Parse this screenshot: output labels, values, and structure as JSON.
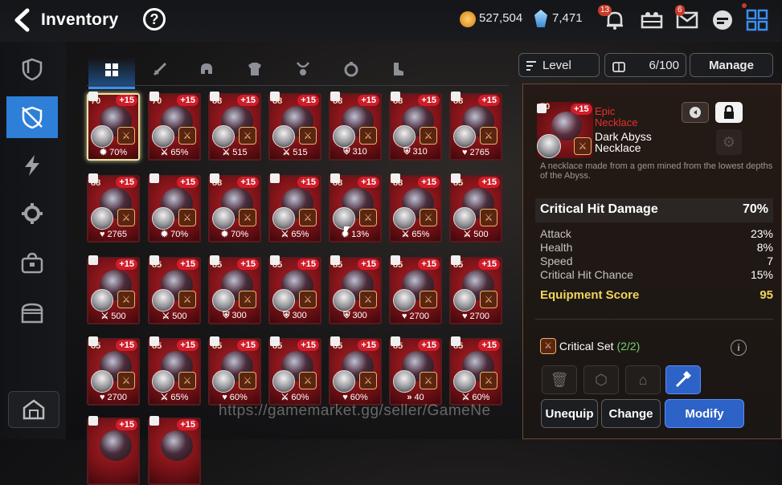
{
  "header": {
    "title": "Inventory",
    "gold": "527,504",
    "crystals": "7,471",
    "notification_count": "13",
    "mail_count": "6"
  },
  "tabs": [
    {
      "name": "all",
      "icon": "grid-icon",
      "active": true
    },
    {
      "name": "weapon",
      "icon": "sword-icon"
    },
    {
      "name": "helmet",
      "icon": "helmet-icon"
    },
    {
      "name": "armor",
      "icon": "armor-icon"
    },
    {
      "name": "necklace",
      "icon": "necklace-icon"
    },
    {
      "name": "ring",
      "icon": "ring-icon"
    },
    {
      "name": "boots",
      "icon": "boots-icon"
    }
  ],
  "sidebar": [
    {
      "name": "hero",
      "icon": "hero-shield-icon"
    },
    {
      "name": "equipment",
      "icon": "equipment-icon",
      "active": true
    },
    {
      "name": "artifacts",
      "icon": "lightning-icon"
    },
    {
      "name": "materials",
      "icon": "gear-icon"
    },
    {
      "name": "bag",
      "icon": "bag-icon"
    },
    {
      "name": "chest",
      "icon": "chest-icon"
    }
  ],
  "sort": {
    "label": "Level",
    "capacity": "6/100",
    "manage": "Manage"
  },
  "grid": [
    [
      {
        "lvl": "70",
        "plus": "+15",
        "stat": "70%",
        "stat_icon": "gear-icon",
        "lock": true,
        "selected": true
      },
      {
        "lvl": "70",
        "plus": "+15",
        "stat": "65%",
        "stat_icon": "sword-icon",
        "lock": true
      },
      {
        "lvl": "88",
        "plus": "+15",
        "stat": "515",
        "stat_icon": "sword-icon",
        "lock": true
      },
      {
        "lvl": "88",
        "plus": "+15",
        "stat": "515",
        "stat_icon": "sword-icon",
        "lock": true
      },
      {
        "lvl": "88",
        "plus": "+15",
        "stat": "310",
        "stat_icon": "shield-icon",
        "lock": true
      },
      {
        "lvl": "88",
        "plus": "+15",
        "stat": "310",
        "stat_icon": "shield-icon",
        "lock": true
      },
      {
        "lvl": "88",
        "plus": "+15",
        "stat": "2765",
        "stat_icon": "heart-icon",
        "lock": true
      }
    ],
    [
      {
        "lvl": "88",
        "plus": "+15",
        "stat": "2765",
        "stat_icon": "heart-icon",
        "lock": true
      },
      {
        "lvl": "",
        "plus": "+15",
        "stat": "70%",
        "stat_icon": "gear-icon",
        "lock": true
      },
      {
        "lvl": "88",
        "plus": "+15",
        "stat": "70%",
        "stat_icon": "gear-icon",
        "lock": true
      },
      {
        "lvl": "",
        "plus": "+15",
        "stat": "65%",
        "stat_icon": "sword-icon",
        "lock": true
      },
      {
        "lvl": "88",
        "plus": "+15",
        "stat": "13%",
        "stat_icon": "gear-icon",
        "lock": true
      },
      {
        "lvl": "88",
        "plus": "+15",
        "stat": "65%",
        "stat_icon": "sword-icon",
        "lock": true
      },
      {
        "lvl": "85",
        "plus": "+15",
        "stat": "500",
        "stat_icon": "sword-icon",
        "lock": true
      }
    ],
    [
      {
        "lvl": "",
        "plus": "+15",
        "stat": "500",
        "stat_icon": "sword-icon",
        "lock": true
      },
      {
        "lvl": "85",
        "plus": "+15",
        "stat": "500",
        "stat_icon": "sword-icon",
        "lock": true
      },
      {
        "lvl": "85",
        "plus": "+15",
        "stat": "300",
        "stat_icon": "shield-icon",
        "lock": true
      },
      {
        "lvl": "85",
        "plus": "+15",
        "stat": "300",
        "stat_icon": "shield-icon",
        "lock": true
      },
      {
        "lvl": "85",
        "plus": "+15",
        "stat": "300",
        "stat_icon": "shield-icon",
        "lock": true
      },
      {
        "lvl": "85",
        "plus": "+15",
        "stat": "2700",
        "stat_icon": "heart-icon",
        "lock": true
      },
      {
        "lvl": "85",
        "plus": "+15",
        "stat": "2700",
        "stat_icon": "heart-icon",
        "lock": true
      }
    ],
    [
      {
        "lvl": "85",
        "plus": "+15",
        "stat": "2700",
        "stat_icon": "heart-icon",
        "lock": true
      },
      {
        "lvl": "85",
        "plus": "+15",
        "stat": "65%",
        "stat_icon": "sword-icon",
        "lock": true
      },
      {
        "lvl": "85",
        "plus": "+15",
        "stat": "60%",
        "stat_icon": "heart-icon",
        "lock": true
      },
      {
        "lvl": "85",
        "plus": "+15",
        "stat": "60%",
        "stat_icon": "sword-icon",
        "lock": true
      },
      {
        "lvl": "85",
        "plus": "+15",
        "stat": "60%",
        "stat_icon": "heart-icon",
        "lock": true
      },
      {
        "lvl": "85",
        "plus": "+15",
        "stat": "40",
        "stat_icon": "speed-icon",
        "lock": true
      },
      {
        "lvl": "85",
        "plus": "+15",
        "stat": "60%",
        "stat_icon": "sword-icon",
        "lock": true
      }
    ],
    [
      {
        "lvl": "",
        "plus": "+15",
        "stat": "",
        "stat_icon": "",
        "lock": true
      },
      {
        "lvl": "",
        "plus": "+15",
        "stat": "",
        "stat_icon": "",
        "lock": true
      }
    ]
  ],
  "detail": {
    "level": "70",
    "plus": "+15",
    "rarity": "Epic Necklace",
    "name": "Dark Abyss Necklace",
    "description": "A necklace made from a gem mined from the lowest depths of the Abyss.",
    "main_stat": {
      "label": "Critical Hit Damage",
      "value": "70%"
    },
    "substats": [
      {
        "label": "Attack",
        "value": "23%"
      },
      {
        "label": "Health",
        "value": "8%"
      },
      {
        "label": "Speed",
        "value": "7"
      },
      {
        "label": "Critical Hit Chance",
        "value": "15%"
      }
    ],
    "score": {
      "label": "Equipment Score",
      "value": "95"
    },
    "set": {
      "label": "Critical Set",
      "count": "(2/2)"
    },
    "buttons": {
      "unequip": "Unequip",
      "change": "Change",
      "modify": "Modify"
    }
  },
  "watermark": "https://gamemarket.gg/seller/GameNe",
  "colors": {
    "accent": "#2e7fd8",
    "rarity_epic": "#e4302f",
    "score": "#f1d55c",
    "set_count": "#6fd36b"
  }
}
